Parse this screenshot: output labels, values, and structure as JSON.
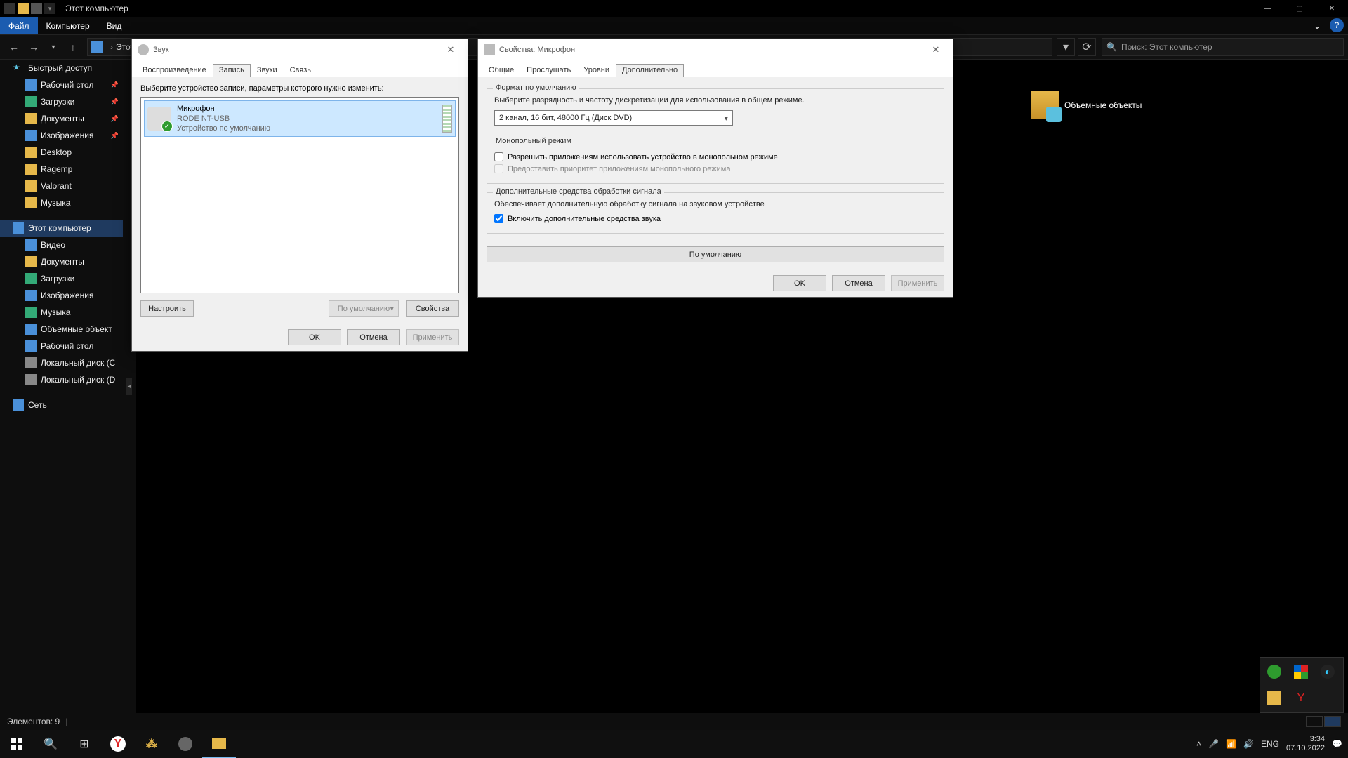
{
  "window": {
    "title": "Этот компьютер"
  },
  "menu": {
    "file": "Файл",
    "computer": "Компьютер",
    "view": "Вид"
  },
  "path": {
    "root": "Этот к...",
    "rootshort": "Этот к"
  },
  "search": {
    "placeholder": "Поиск: Этот компьютер"
  },
  "sidebar": {
    "quick": "Быстрый доступ",
    "items_quick": [
      {
        "label": "Рабочий стол"
      },
      {
        "label": "Загрузки"
      },
      {
        "label": "Документы"
      },
      {
        "label": "Изображения"
      },
      {
        "label": "Desktop"
      },
      {
        "label": "Ragemp"
      },
      {
        "label": "Valorant"
      },
      {
        "label": "Музыка"
      }
    ],
    "thispc": "Этот компьютер",
    "items_pc": [
      {
        "label": "Видео"
      },
      {
        "label": "Документы"
      },
      {
        "label": "Загрузки"
      },
      {
        "label": "Изображения"
      },
      {
        "label": "Музыка"
      },
      {
        "label": "Объемные объект"
      },
      {
        "label": "Рабочий стол"
      },
      {
        "label": "Локальный диск (C"
      },
      {
        "label": "Локальный диск (D"
      }
    ],
    "network": "Сеть"
  },
  "content": {
    "folder_3d": "Объемные объекты"
  },
  "status": {
    "items": "Элементов: 9"
  },
  "taskbar": {
    "lang": "ENG",
    "time": "3:34",
    "date": "07.10.2022"
  },
  "sound_dialog": {
    "title": "Звук",
    "tabs": {
      "playback": "Воспроизведение",
      "recording": "Запись",
      "sounds": "Звуки",
      "comm": "Связь"
    },
    "prompt": "Выберите устройство записи, параметры которого нужно изменить:",
    "device": {
      "name": "Микрофон",
      "sub1": "RODE NT-USB",
      "sub2": "Устройство по умолчанию"
    },
    "buttons": {
      "configure": "Настроить",
      "setdefault": "По умолчанию",
      "props": "Свойства",
      "ok": "OK",
      "cancel": "Отмена",
      "apply": "Применить"
    }
  },
  "props_dialog": {
    "title": "Свойства: Микрофон",
    "tabs": {
      "general": "Общие",
      "listen": "Прослушать",
      "levels": "Уровни",
      "advanced": "Дополнительно"
    },
    "group_format": {
      "title": "Формат по умолчанию",
      "desc": "Выберите разрядность и частоту дискретизации для использования в общем режиме.",
      "combo": "2 канал, 16 бит, 48000 Гц (Диск DVD)"
    },
    "group_mono": {
      "title": "Монопольный режим",
      "chk1": "Разрешить приложениям использовать устройство в монопольном режиме",
      "chk2": "Предоставить приоритет приложениям монопольного режима"
    },
    "group_dsp": {
      "title": "Дополнительные средства обработки сигнала",
      "desc": "Обеспечивает дополнительную обработку сигнала на звуковом устройстве",
      "chk": "Включить дополнительные средства звука"
    },
    "buttons": {
      "defaults": "По умолчанию",
      "ok": "OK",
      "cancel": "Отмена",
      "apply": "Применить"
    }
  }
}
